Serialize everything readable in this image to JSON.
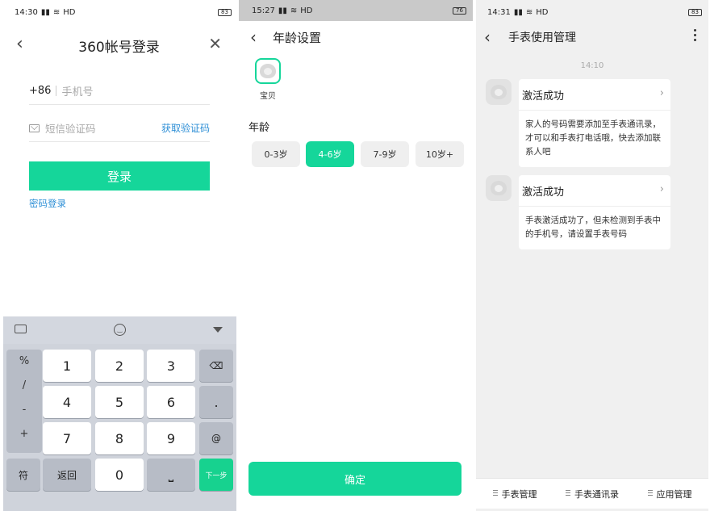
{
  "screen1": {
    "status": {
      "time": "14:30",
      "net": "HD",
      "battery": "83"
    },
    "title": "360帐号登录",
    "phone": {
      "country_code": "+86",
      "placeholder": "手机号"
    },
    "sms": {
      "placeholder": "短信验证码",
      "get_code": "获取验证码"
    },
    "login_button": "登录",
    "password_login": "密码登录",
    "keyboard": {
      "side": [
        "%",
        "/",
        "-",
        "+"
      ],
      "keys": [
        "1",
        "2",
        "3",
        "4",
        "5",
        "6",
        "7",
        "8",
        "9",
        "0"
      ],
      "dot": ".",
      "at": "@",
      "fu": "符",
      "back": "返回",
      "next": "下一步"
    }
  },
  "screen2": {
    "status": {
      "time": "15:27",
      "net": "HD",
      "battery": "76"
    },
    "title": "年龄设置",
    "baby": "宝贝",
    "age_label": "年龄",
    "ages": [
      "0-3岁",
      "4-6岁",
      "7-9岁",
      "10岁+"
    ],
    "selected_age": "4-6岁",
    "confirm": "确定"
  },
  "screen3": {
    "status": {
      "time": "14:31",
      "net": "HD",
      "battery": "83"
    },
    "title": "手表使用管理",
    "time": "14:10",
    "messages": [
      {
        "title": "激活成功",
        "body": "家人的号码需要添加至手表通讯录，才可以和手表打电话哦，快去添加联系人吧"
      },
      {
        "title": "激活成功",
        "body": "手表激活成功了，但未检测到手表中的手机号，请设置手表号码"
      }
    ],
    "tabs": [
      "手表管理",
      "手表通讯录",
      "应用管理"
    ]
  },
  "colors": {
    "accent": "#15d69a",
    "link": "#2e8fd6"
  }
}
